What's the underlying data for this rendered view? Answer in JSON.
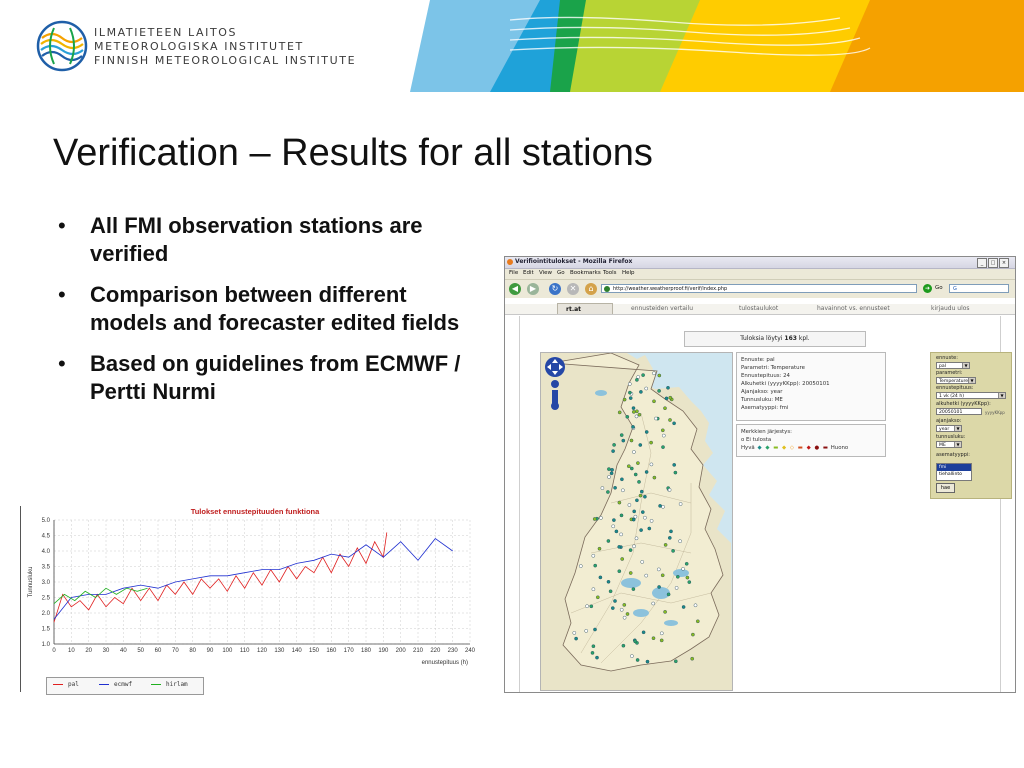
{
  "header": {
    "org_lines": [
      "ILMATIETEEN LAITOS",
      "METEOROLOGISKA INSTITUTET",
      "FINNISH METEOROLOGICAL INSTITUTE"
    ],
    "logo_icon": "fmi-logo-icon",
    "banner_colors": [
      "#7cc4e8",
      "#1fa2d9",
      "#1aa34a",
      "#b8d434",
      "#ffcc00",
      "#f5a100"
    ]
  },
  "slide": {
    "title": "Verification – Results for all stations",
    "bullets": [
      "All FMI observation stations are verified",
      "Comparison between different models and forecaster edited fields",
      "Based on guidelines from ECMWF / Pertti Nurmi"
    ],
    "bullet_char": "•"
  },
  "chart_data": {
    "type": "line",
    "title": "Tulokset ennustepituuden funktiona",
    "xlabel": "ennustepituus (h)",
    "ylabel": "Tunnusluku",
    "xlim": [
      0,
      240
    ],
    "ylim": [
      1.0,
      5.0
    ],
    "xticks": [
      0,
      10,
      20,
      30,
      40,
      50,
      60,
      70,
      80,
      90,
      100,
      110,
      120,
      130,
      140,
      150,
      160,
      170,
      180,
      190,
      200,
      210,
      220,
      230,
      240
    ],
    "yticks": [
      "1.0",
      "1.5",
      "2.0",
      "2.5",
      "3.0",
      "3.5",
      "4.0",
      "4.5",
      "5.0"
    ],
    "grid": true,
    "legend": "bottom-left",
    "series": [
      {
        "name": "pal",
        "color": "#e02020",
        "x": [
          0,
          5,
          10,
          15,
          20,
          25,
          30,
          35,
          40,
          45,
          50,
          55,
          60,
          65,
          70,
          75,
          80,
          85,
          90,
          95,
          100,
          105,
          110,
          115,
          120,
          125,
          130,
          135,
          140,
          145,
          150,
          155,
          160,
          165,
          170,
          175,
          180,
          185,
          190,
          192
        ],
        "y": [
          1.7,
          2.6,
          2.2,
          2.4,
          2.1,
          2.6,
          2.2,
          2.5,
          2.3,
          2.8,
          2.4,
          2.8,
          2.4,
          2.9,
          2.6,
          3.0,
          2.6,
          3.1,
          2.8,
          3.1,
          2.7,
          3.2,
          2.8,
          3.3,
          2.9,
          3.4,
          3.0,
          3.5,
          3.1,
          3.5,
          3.3,
          3.8,
          3.3,
          3.9,
          3.5,
          4.1,
          3.6,
          4.3,
          3.8,
          4.6
        ]
      },
      {
        "name": "ecmwf",
        "color": "#2030d0",
        "x": [
          0,
          10,
          20,
          30,
          40,
          50,
          60,
          70,
          80,
          90,
          100,
          110,
          120,
          130,
          140,
          150,
          160,
          170,
          180,
          190,
          200,
          210,
          220,
          230
        ],
        "y": [
          1.8,
          2.5,
          2.6,
          2.6,
          2.8,
          2.9,
          2.8,
          3.0,
          3.1,
          3.2,
          3.2,
          3.3,
          3.4,
          3.4,
          3.6,
          3.7,
          3.9,
          3.8,
          4.2,
          3.8,
          4.3,
          3.7,
          4.4,
          4.0
        ]
      },
      {
        "name": "hirlam",
        "color": "#20b020",
        "x": [
          0,
          6,
          12,
          18,
          24,
          30,
          36,
          42,
          48,
          54
        ],
        "y": [
          2.3,
          2.6,
          2.4,
          2.7,
          2.5,
          2.8,
          2.6,
          2.8,
          2.7,
          2.8
        ]
      }
    ]
  },
  "browser": {
    "window_title": "Verifiointitulokset - Mozilla Firefox",
    "window_buttons": [
      "_",
      "□",
      "×"
    ],
    "menu": [
      "File",
      "Edit",
      "View",
      "Go",
      "Bookmarks",
      "Tools",
      "Help"
    ],
    "nav_icons": [
      "back-icon",
      "forward-icon",
      "reload-icon",
      "stop-icon",
      "home-icon"
    ],
    "url": "http://weather.weatherproof.fi/verif/index.php",
    "go_label": "Go",
    "search_value": "G",
    "tabs": [
      "rt.at",
      "ennusteiden vertailu",
      "tulostaulukot",
      "havainnot vs. ennusteet",
      "kirjaudu ulos"
    ],
    "results_prefix": "Tuloksia löytyi",
    "results_count": "163",
    "results_suffix": "kpl.",
    "info": [
      "Ennuste: pal",
      "Parametri: Temperature",
      "Ennustepituus: 24",
      "Alkuhetki (yyyyKKpp): 20050101",
      "Ajanjakso: year",
      "Tunnusluku: ME",
      "Asematyyppi: fmi"
    ],
    "legend_title": "Merkkien järjestys:",
    "legend_none": "o Ei tulosta",
    "legend_good": "Hyvä",
    "legend_bad": "Huono",
    "legend_symbol_colors": [
      "#1a8a8a",
      "#2aa36a",
      "#88bb22",
      "#e0c020",
      "#f0a020",
      "#d05020",
      "#c01818",
      "#8a1010"
    ],
    "form": {
      "ennuste_label": "ennuste:",
      "ennuste_value": "pal",
      "parametri_label": "parametri:",
      "parametri_value": "Temperature",
      "ennustepituus_label": "ennustepituus:",
      "ennustepituus_value": "1 vk (24 h)",
      "alkuhetki_label": "alkuhetki (yyyyKKpp):",
      "alkuhetki_value": "20050101",
      "alkuhetki_hint": "yyyyKKpp",
      "ajanjakso_label": "ajanjakso:",
      "ajanjakso_value": "year",
      "tunnusluku_label": "tunnusluku:",
      "tunnusluku_value": "ME",
      "asematyyppi_label": "asematyyppi:",
      "asematyyppi_options": [
        "fmi",
        "tiehallinto"
      ],
      "submit_label": "hae"
    }
  }
}
